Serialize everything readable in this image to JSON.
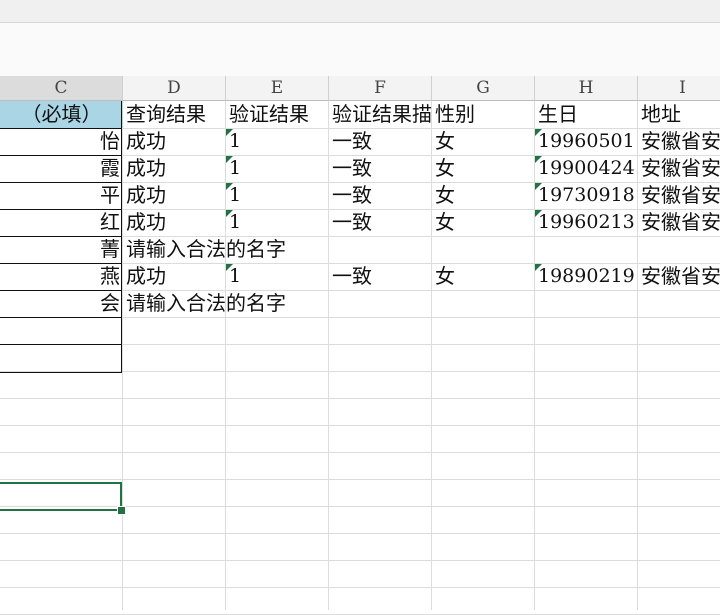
{
  "columns": [
    "C",
    "D",
    "E",
    "F",
    "G",
    "H",
    "I"
  ],
  "header_row": {
    "C": "（必填）",
    "D": "查询结果",
    "E": "验证结果",
    "F": "验证结果描",
    "G": "性别",
    "H": "生日",
    "I": "地址"
  },
  "rows": [
    {
      "C": "怡",
      "D": "成功",
      "E": "1",
      "F": "一致",
      "G": "女",
      "H": "19960501",
      "I": "安徽省安"
    },
    {
      "C": "霞",
      "D": "成功",
      "E": "1",
      "F": "一致",
      "G": "女",
      "H": "19900424",
      "I": "安徽省安"
    },
    {
      "C": "平",
      "D": "成功",
      "E": "1",
      "F": "一致",
      "G": "女",
      "H": "19730918",
      "I": "安徽省安"
    },
    {
      "C": "红",
      "D": "成功",
      "E": "1",
      "F": "一致",
      "G": "女",
      "H": "19960213",
      "I": "安徽省安"
    },
    {
      "C": "菁",
      "D": "请输入合法的名字",
      "E": "",
      "F": "",
      "G": "",
      "H": "",
      "I": ""
    },
    {
      "C": "燕",
      "D": "成功",
      "E": "1",
      "F": "一致",
      "G": "女",
      "H": "19890219",
      "I": "安徽省安"
    },
    {
      "C": "会",
      "D": "请输入合法的名字",
      "E": "",
      "F": "",
      "G": "",
      "H": "",
      "I": ""
    }
  ],
  "colors": {
    "header_highlight": "#a9d5e4",
    "selection_green": "#217346",
    "gridline": "#dcdcdc"
  }
}
